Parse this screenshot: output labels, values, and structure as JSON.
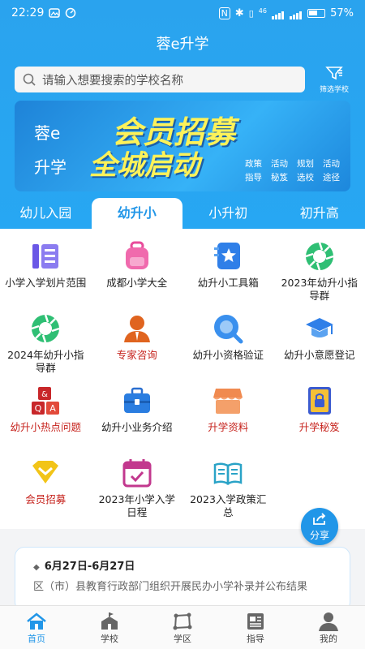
{
  "status": {
    "time": "22:29",
    "battery": "57%",
    "net": "46"
  },
  "app_title": "蓉e升学",
  "search": {
    "placeholder": "请输入想要搜索的学校名称"
  },
  "filter_label": "筛选学校",
  "banner": {
    "side_top": "蓉e",
    "side_bottom": "升学",
    "line1": "会员招募",
    "line2": "全城启动",
    "tags": [
      "政策",
      "活动",
      "规划",
      "活动",
      "指导",
      "秘笈",
      "选校",
      "途径"
    ]
  },
  "tabs": [
    {
      "label": "幼儿入园",
      "active": false
    },
    {
      "label": "幼升小",
      "active": true
    },
    {
      "label": "小升初",
      "active": false
    },
    {
      "label": "初升高",
      "active": false
    }
  ],
  "grid": [
    {
      "label": "小学入学划片范围",
      "icon": "list-icon",
      "red": false
    },
    {
      "label": "成都小学大全",
      "icon": "school-bag-icon",
      "red": false
    },
    {
      "label": "幼升小工具箱",
      "icon": "star-book-icon",
      "red": false
    },
    {
      "label": "2023年幼升小指导群",
      "icon": "aperture-icon",
      "red": false
    },
    {
      "label": "2024年幼升小指导群",
      "icon": "aperture-icon",
      "red": false
    },
    {
      "label": "专家咨询",
      "icon": "expert-icon",
      "red": true
    },
    {
      "label": "幼升小资格验证",
      "icon": "search-bubble-icon",
      "red": false
    },
    {
      "label": "幼升小意愿登记",
      "icon": "graduation-cap-icon",
      "red": false
    },
    {
      "label": "幼升小热点问题",
      "icon": "qa-blocks-icon",
      "red": true
    },
    {
      "label": "幼升小业务介绍",
      "icon": "toolbox-icon",
      "red": false
    },
    {
      "label": "升学资料",
      "icon": "shop-icon",
      "red": true
    },
    {
      "label": "升学秘笈",
      "icon": "locked-book-icon",
      "red": true
    },
    {
      "label": "会员招募",
      "icon": "diamond-icon",
      "red": true
    },
    {
      "label": "2023年小学入学日程",
      "icon": "calendar-icon",
      "red": false
    },
    {
      "label": "2023入学政策汇总",
      "icon": "open-book-icon",
      "red": false
    }
  ],
  "share_label": "分享",
  "news": {
    "date": "6月27日-6月27日",
    "desc": "区（市）县教育行政部门组织开展民办小学补录并公布结果"
  },
  "bottom_nav": [
    {
      "label": "首页",
      "icon": "home-icon",
      "active": true
    },
    {
      "label": "学校",
      "icon": "school-icon",
      "active": false
    },
    {
      "label": "学区",
      "icon": "district-icon",
      "active": false
    },
    {
      "label": "指导",
      "icon": "news-icon",
      "active": false
    },
    {
      "label": "我的",
      "icon": "user-icon",
      "active": false
    }
  ],
  "colors": {
    "primary": "#2196e8",
    "header": "#27a7f3",
    "red_label": "#c6221c"
  }
}
